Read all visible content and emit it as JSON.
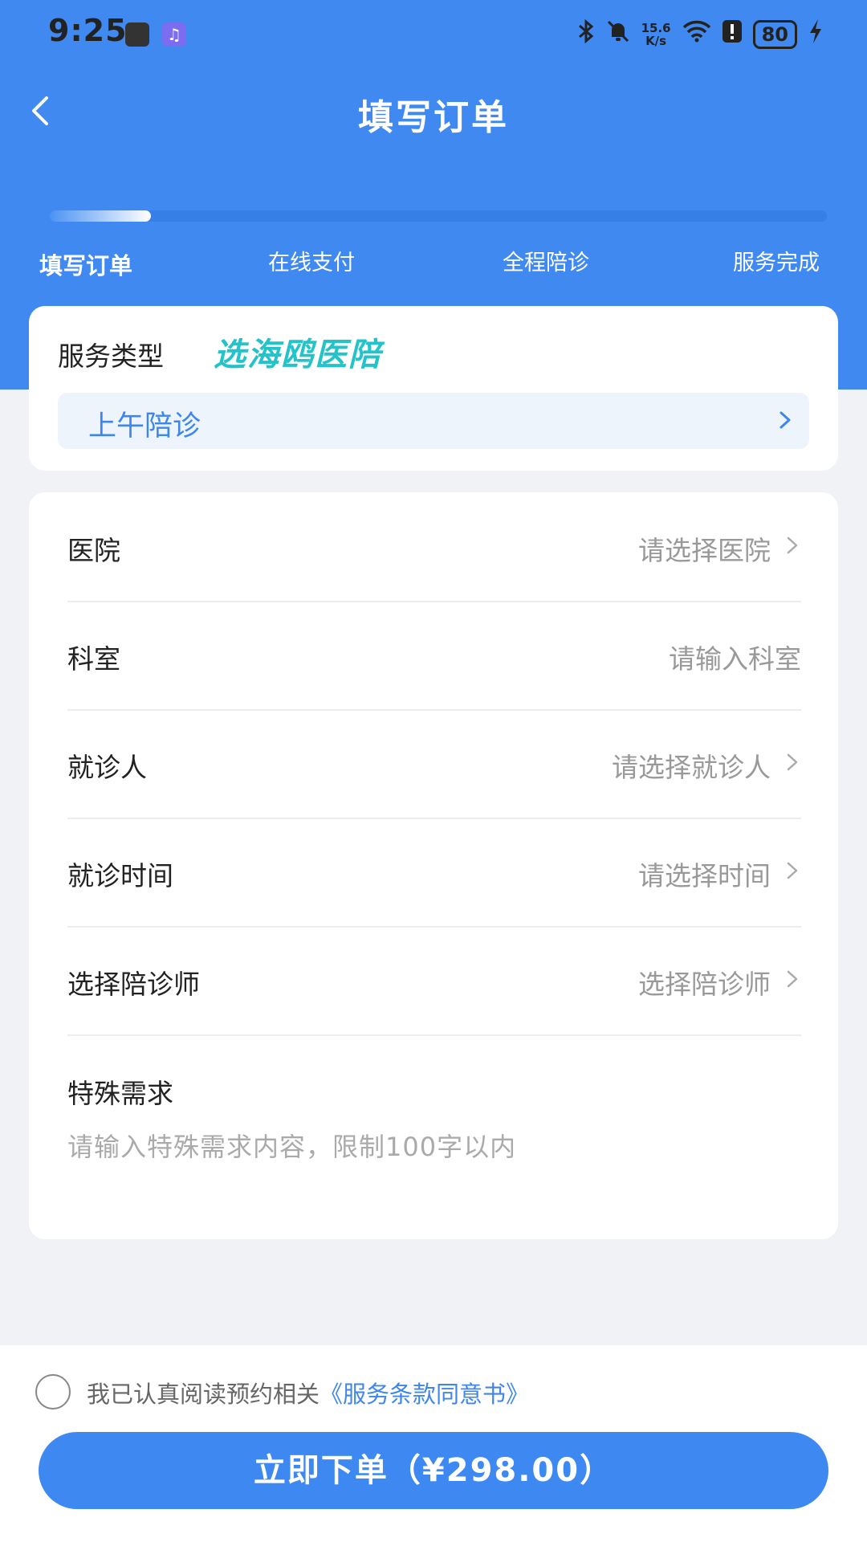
{
  "status_bar": {
    "time": "9:25",
    "net_speed_value": "15.6",
    "net_speed_unit": "K/s",
    "battery": "80",
    "icons": [
      "app-badge-icon",
      "music-app-icon",
      "bluetooth-icon",
      "mute-bell-icon",
      "wifi-icon",
      "alert-icon",
      "battery-icon",
      "charging-icon"
    ]
  },
  "header": {
    "title": "填写订单"
  },
  "progress": {
    "current_step": 1,
    "fill_fraction": 0.13,
    "steps": [
      "填写订单",
      "在线支付",
      "全程陪诊",
      "服务完成"
    ]
  },
  "service": {
    "label": "服务类型",
    "brand": "选海鸥医陪",
    "selected": "上午陪诊"
  },
  "form": {
    "rows": [
      {
        "label": "医院",
        "placeholder": "请选择医院"
      },
      {
        "label": "科室",
        "placeholder": "请输入科室"
      },
      {
        "label": "就诊人",
        "placeholder": "请选择就诊人"
      },
      {
        "label": "就诊时间",
        "placeholder": "请选择时间"
      },
      {
        "label": "选择陪诊师",
        "placeholder": "选择陪诊师"
      }
    ],
    "special": {
      "label": "特殊需求",
      "placeholder": "请输入特殊需求内容，限制100字以内"
    }
  },
  "agreement": {
    "text": "我已认真阅读预约相关",
    "link": "《服务条款同意书》",
    "checked": false
  },
  "submit": {
    "label": "立即下单（¥298.00）"
  },
  "colors": {
    "primary": "#4089f1",
    "brand": "#24c3c9",
    "placeholder": "#999999"
  }
}
